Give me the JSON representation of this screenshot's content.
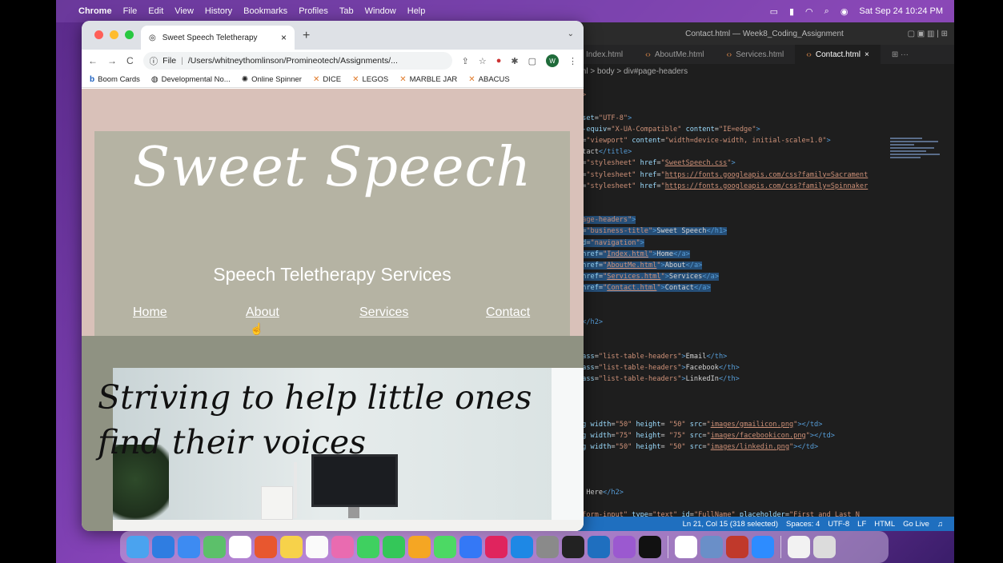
{
  "menubar": {
    "apple": "",
    "app": "Chrome",
    "items": [
      "File",
      "Edit",
      "View",
      "History",
      "Bookmarks",
      "Profiles",
      "Tab",
      "Window",
      "Help"
    ],
    "datetime": "Sat Sep 24  10:24 PM"
  },
  "chrome": {
    "tab_title": "Sweet Speech Teletherapy",
    "url": "/Users/whitneythomlinson/Promineotech/Assignments/...",
    "url_prefix": "File",
    "avatar_letter": "W",
    "bookmarks": [
      "Boom Cards",
      "Developmental No...",
      "Online Spinner",
      "DICE",
      "LEGOS",
      "MARBLE JAR",
      "ABACUS"
    ]
  },
  "site": {
    "title": "Sweet Speech",
    "subtitle": "Speech Teletherapy Services",
    "nav": [
      "Home",
      "About",
      "Services",
      "Contact"
    ],
    "tagline": "Striving to help little ones find their voices"
  },
  "vscode": {
    "window_title": "Contact.html — Week8_Coding_Assignment",
    "tabs": [
      "Index.html",
      "AboutMe.html",
      "Services.html",
      "Contact.html"
    ],
    "breadcrumb": "ml  >  body  >  div#page-headers",
    "status": [
      "Ln 21, Col 15 (318 selected)",
      "Spaces: 4",
      "UTF-8",
      "LF",
      "HTML",
      "Go Live"
    ]
  },
  "colors": {
    "page_bg": "#d9c1b9",
    "header_bg": "#b5b3a3",
    "band_bg": "#8f9282",
    "vscode_status": "#1f6fbf"
  }
}
